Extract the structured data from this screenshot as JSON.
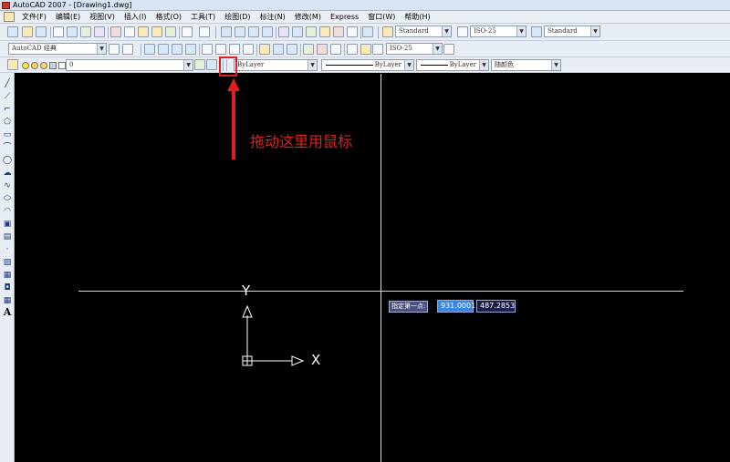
{
  "window": {
    "title": "AutoCAD 2007 - [Drawing1.dwg]"
  },
  "menu": {
    "items": [
      "文件(F)",
      "编辑(E)",
      "视图(V)",
      "插入(I)",
      "格式(O)",
      "工具(T)",
      "绘图(D)",
      "标注(N)",
      "修改(M)",
      "Express",
      "窗口(W)",
      "帮助(H)"
    ]
  },
  "toolbars": {
    "text_style": "Standard",
    "dim_style": "ISO-25",
    "table_style": "Standard",
    "workspace": "AutoCAD 经典",
    "dim_style_2": "ISO-25",
    "layer": "0",
    "color": "ByLayer",
    "linetype": "ByLayer",
    "lineweight": "ByLayer",
    "plot_style": "随颜色"
  },
  "annotation": {
    "text": "拖动这里用鼠标"
  },
  "ucs": {
    "x_label": "X",
    "y_label": "Y"
  },
  "dynamic_input": {
    "prompt": "指定第一点:",
    "x_value": "931.0001",
    "y_value": "487.2853"
  },
  "colors": {
    "canvas": "#000000",
    "annotation": "#e02020",
    "crosshair": "#d8d8d8"
  },
  "icons": {
    "left_toolbar": [
      "line-icon",
      "construction-line-icon",
      "polyline-icon",
      "polygon-icon",
      "rectangle-icon",
      "arc-icon",
      "circle-icon",
      "revision-cloud-icon",
      "spline-icon",
      "ellipse-icon",
      "ellipse-arc-icon",
      "insert-block-icon",
      "make-block-icon",
      "point-icon",
      "hatch-icon",
      "gradient-icon",
      "region-icon",
      "table-icon",
      "multiline-text-icon"
    ]
  }
}
